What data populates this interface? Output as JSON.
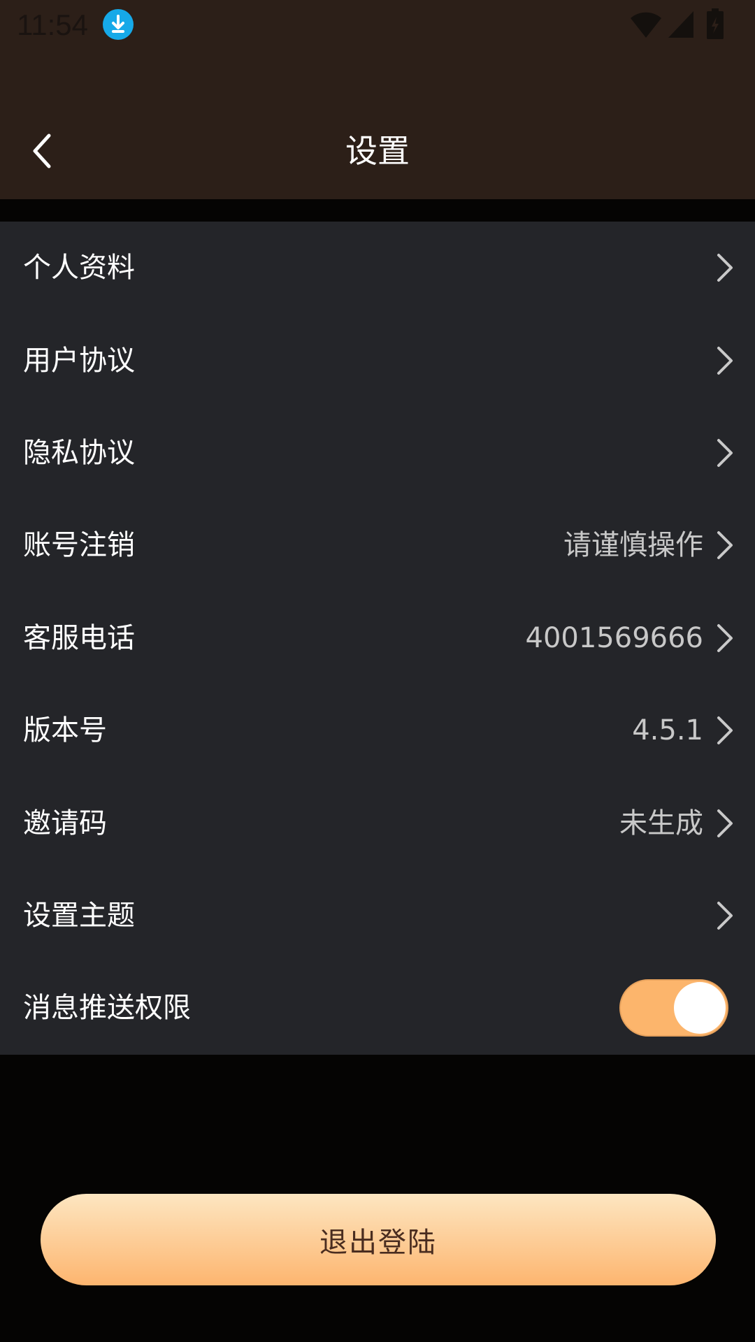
{
  "status_bar": {
    "time": "11:54",
    "icons": [
      "download-icon",
      "wifi-icon",
      "signal-icon",
      "battery-icon"
    ]
  },
  "header": {
    "title": "设置",
    "back_icon": "chevron-left-icon"
  },
  "settings": {
    "rows": [
      {
        "label": "个人资料",
        "value": ""
      },
      {
        "label": "用户协议",
        "value": ""
      },
      {
        "label": "隐私协议",
        "value": ""
      },
      {
        "label": "账号注销",
        "value": "请谨慎操作"
      },
      {
        "label": "客服电话",
        "value": "4001569666"
      },
      {
        "label": "版本号",
        "value": "4.5.1"
      },
      {
        "label": "邀请码",
        "value": "未生成"
      },
      {
        "label": "设置主题",
        "value": ""
      }
    ],
    "push": {
      "label": "消息推送权限",
      "enabled": true
    }
  },
  "logout": {
    "label": "退出登陆"
  },
  "colors": {
    "header_bg": "#2c1f18",
    "list_bg": "#242529",
    "page_bg": "#050403",
    "accent": "#fcb56c",
    "logout_text": "#4a2d20"
  }
}
